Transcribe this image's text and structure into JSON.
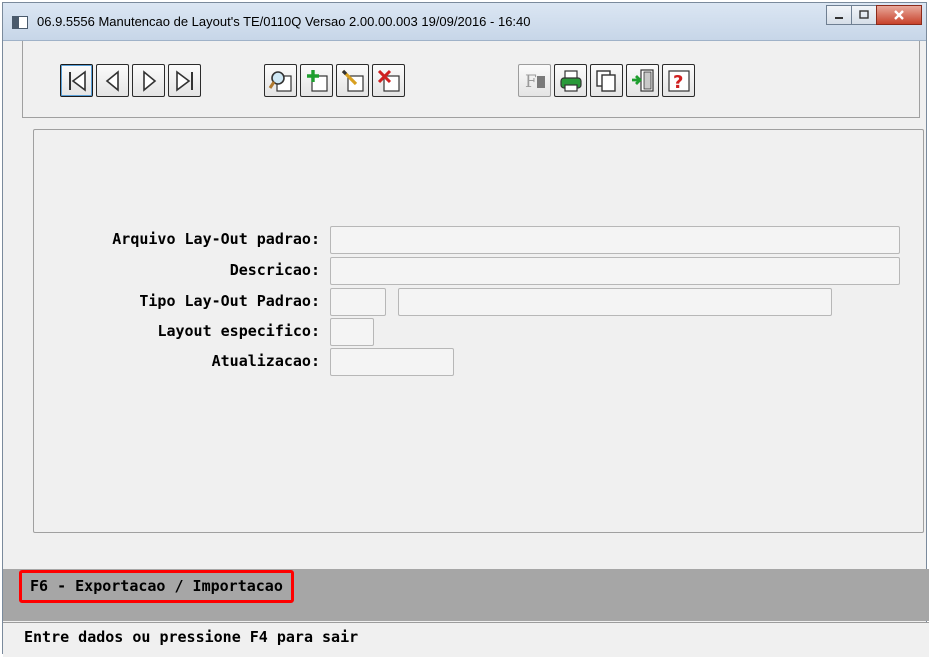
{
  "window": {
    "title": "06.9.5556 Manutencao  de Layout's TE/0110Q Versao 2.00.00.003 19/09/2016 - 16:40",
    "minimize_icon": "minimize-icon",
    "maximize_icon": "maximize-icon",
    "close_icon": "close-icon"
  },
  "toolbar": {
    "buttons": [
      {
        "name": "first-record-button",
        "icon": "first-record-icon"
      },
      {
        "name": "previous-record-button",
        "icon": "previous-record-icon"
      },
      {
        "name": "next-record-button",
        "icon": "next-record-icon"
      },
      {
        "name": "last-record-button",
        "icon": "last-record-icon"
      },
      {
        "name": "search-button",
        "icon": "search-icon"
      },
      {
        "name": "add-button",
        "icon": "add-icon"
      },
      {
        "name": "edit-button",
        "icon": "edit-icon"
      },
      {
        "name": "delete-button",
        "icon": "delete-icon"
      },
      {
        "name": "filter-button",
        "icon": "filter-icon",
        "label": "F",
        "disabled": true
      },
      {
        "name": "print-button",
        "icon": "print-icon"
      },
      {
        "name": "copy-button",
        "icon": "copy-icon"
      },
      {
        "name": "exit-button",
        "icon": "exit-icon"
      },
      {
        "name": "help-button",
        "icon": "help-icon",
        "label": "?"
      }
    ]
  },
  "form": {
    "arquivo_label": "Arquivo Lay-Out padrao:",
    "arquivo_value": "",
    "descricao_label": "Descricao:",
    "descricao_value": "",
    "tipo_label": "Tipo Lay-Out Padrao:",
    "tipo_code_value": "",
    "tipo_desc_value": "",
    "layout_label": "Layout especifico:",
    "layout_value": "",
    "atualizacao_label": "Atualizacao:",
    "atualizacao_value": ""
  },
  "message": "F6 - Exportacao / Importacao",
  "status": "Entre dados ou pressione F4 para sair",
  "colors": {
    "highlight": "#ff0000",
    "message_bar": "#a6a6a6",
    "window_bg": "#f0f0f0"
  }
}
